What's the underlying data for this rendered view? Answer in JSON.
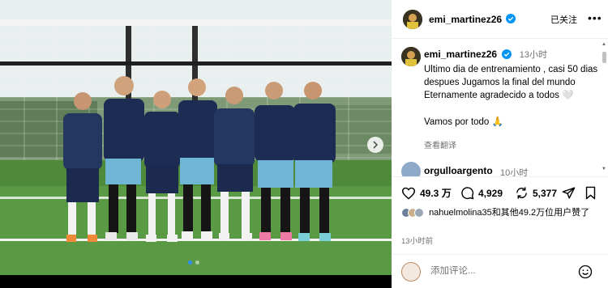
{
  "header": {
    "username": "emi_martinez26",
    "follow_label": "已关注",
    "more_label": "•••"
  },
  "post": {
    "username": "emi_martinez26",
    "time_ago": "13小时",
    "caption": "Ultimo dia de entrenamiento , casi 50 dias despues Jugamos la final del mundo\nEternamente agradecido a todos 🤍\n\nVamos por todo 🙏",
    "translate_label": "查看翻译"
  },
  "comments": [
    {
      "username": "orgulloargento",
      "time_ago": "10小时"
    }
  ],
  "actions": {
    "likes_count": "49.3 万",
    "comments_count": "4,929",
    "shares_count": "5,377"
  },
  "likes_summary": {
    "text": "nahuelmolina35和其他49.2万位用户赞了"
  },
  "posted_time": "13小时前",
  "comment_input": {
    "placeholder": "添加评论..."
  },
  "colors": {
    "verified": "#0095f6",
    "carousel_dot_active": "#2f8cff",
    "muted_text": "#737373"
  },
  "icons": [
    "heart-icon",
    "comment-icon",
    "share-icon",
    "send-icon",
    "bookmark-icon",
    "emoji-icon",
    "verified-icon",
    "chevron-right-icon",
    "more-icon"
  ]
}
